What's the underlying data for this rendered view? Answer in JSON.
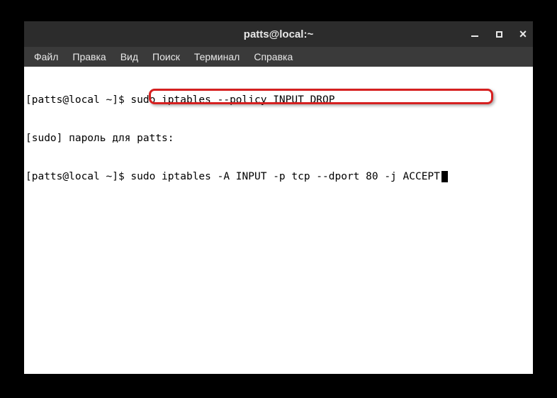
{
  "window": {
    "title": "patts@local:~"
  },
  "menubar": {
    "items": [
      "Файл",
      "Правка",
      "Вид",
      "Поиск",
      "Терминал",
      "Справка"
    ]
  },
  "terminal": {
    "line1_prompt": "[patts@local ~]$ ",
    "line1_cmd": "sudo iptables --policy INPUT DROP",
    "line2": "[sudo] пароль для patts:",
    "line3_prompt": "[patts@local ~]$ ",
    "line3_cmd": "sudo iptables -A INPUT -p tcp --dport 80 -j ACCEPT"
  }
}
